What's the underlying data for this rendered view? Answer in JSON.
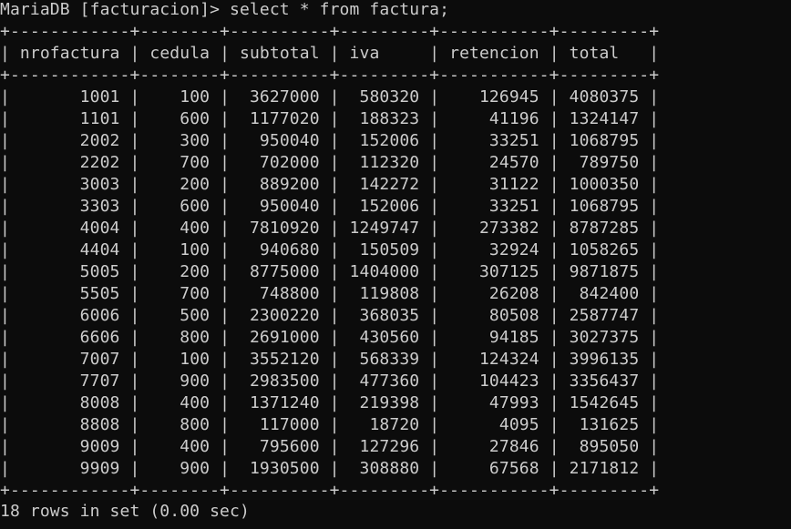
{
  "terminal": {
    "prompt": "MariaDB [facturacion]> ",
    "command": "select * from factura;",
    "columns": [
      "nrofactura",
      "cedula",
      "subtotal",
      "iva",
      "retencion",
      "total"
    ],
    "rows": [
      [
        "1001",
        "100",
        "3627000",
        "580320",
        "126945",
        "4080375"
      ],
      [
        "1101",
        "600",
        "1177020",
        "188323",
        "41196",
        "1324147"
      ],
      [
        "2002",
        "300",
        "950040",
        "152006",
        "33251",
        "1068795"
      ],
      [
        "2202",
        "700",
        "702000",
        "112320",
        "24570",
        "789750"
      ],
      [
        "3003",
        "200",
        "889200",
        "142272",
        "31122",
        "1000350"
      ],
      [
        "3303",
        "600",
        "950040",
        "152006",
        "33251",
        "1068795"
      ],
      [
        "4004",
        "400",
        "7810920",
        "1249747",
        "273382",
        "8787285"
      ],
      [
        "4404",
        "100",
        "940680",
        "150509",
        "32924",
        "1058265"
      ],
      [
        "5005",
        "200",
        "8775000",
        "1404000",
        "307125",
        "9871875"
      ],
      [
        "5505",
        "700",
        "748800",
        "119808",
        "26208",
        "842400"
      ],
      [
        "6006",
        "500",
        "2300220",
        "368035",
        "80508",
        "2587747"
      ],
      [
        "6606",
        "800",
        "2691000",
        "430560",
        "94185",
        "3027375"
      ],
      [
        "7007",
        "100",
        "3552120",
        "568339",
        "124324",
        "3996135"
      ],
      [
        "7707",
        "900",
        "2983500",
        "477360",
        "104423",
        "3356437"
      ],
      [
        "8008",
        "400",
        "1371240",
        "219398",
        "47993",
        "1542645"
      ],
      [
        "8808",
        "800",
        "117000",
        "18720",
        "4095",
        "131625"
      ],
      [
        "9009",
        "400",
        "795600",
        "127296",
        "27846",
        "895050"
      ],
      [
        "9909",
        "900",
        "1930500",
        "308880",
        "67568",
        "2171812"
      ]
    ],
    "status": "18 rows in set (0.00 sec)"
  }
}
